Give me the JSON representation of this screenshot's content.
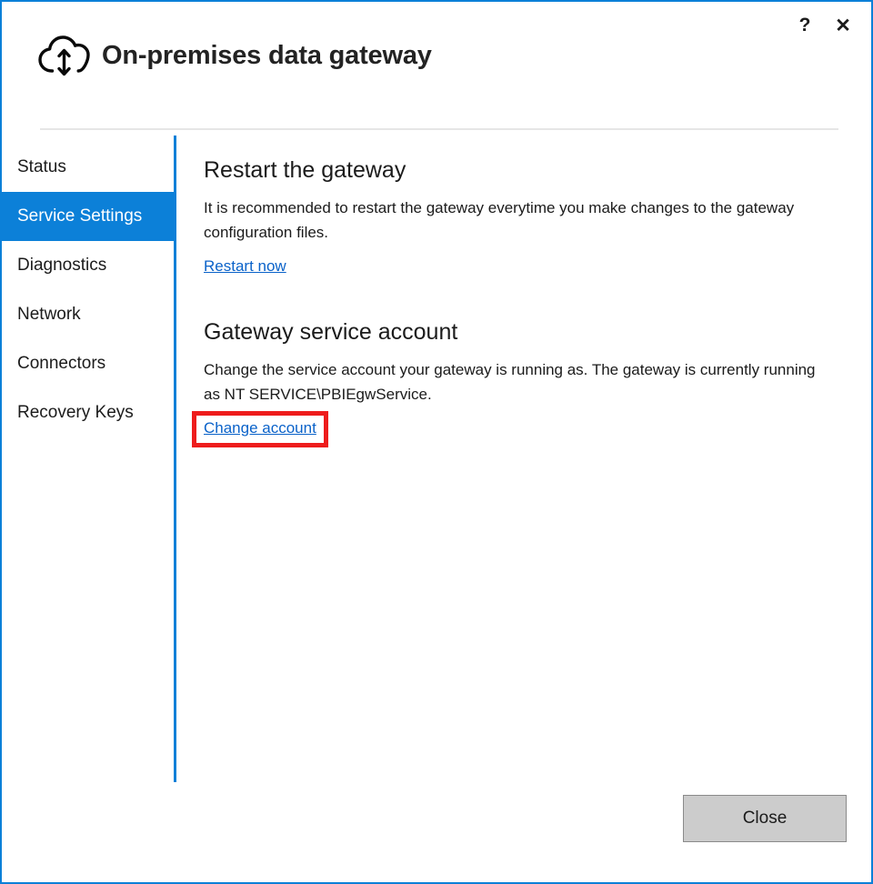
{
  "window": {
    "border_color": "#0c80d8",
    "accent_color": "#0c80d8",
    "link_color": "#0a62c9",
    "annotation_color": "#ee1c1c"
  },
  "titlebar": {
    "app_title": "On-premises data gateway",
    "icon": "cloud-sync-icon",
    "help_label": "?",
    "close_label": "✕"
  },
  "sidebar": {
    "items": [
      {
        "label": "Status",
        "selected": false
      },
      {
        "label": "Service Settings",
        "selected": true
      },
      {
        "label": "Diagnostics",
        "selected": false
      },
      {
        "label": "Network",
        "selected": false
      },
      {
        "label": "Connectors",
        "selected": false
      },
      {
        "label": "Recovery Keys",
        "selected": false
      }
    ]
  },
  "main": {
    "restart_section": {
      "title": "Restart the gateway",
      "body": "It is recommended to restart the gateway everytime you make changes to the gateway configuration files.",
      "link": "Restart now"
    },
    "service_account_section": {
      "title": "Gateway service account",
      "body": "Change the service account your gateway is running as. The gateway is currently running as NT SERVICE\\PBIEgwService.",
      "link": "Change account",
      "highlighted": true
    }
  },
  "footer": {
    "close_label": "Close"
  }
}
